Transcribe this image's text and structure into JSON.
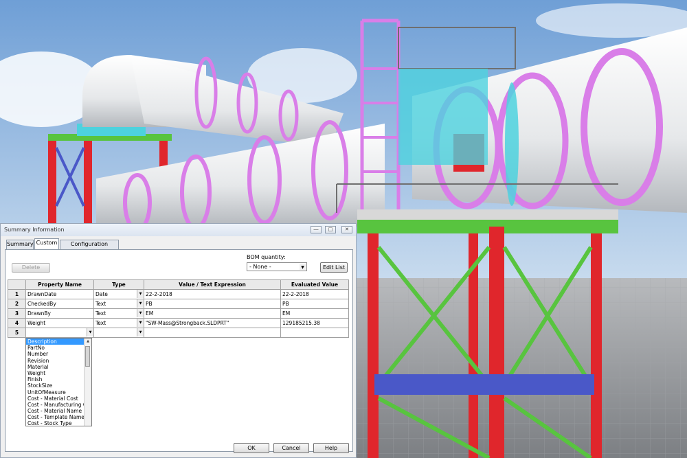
{
  "dialog": {
    "title": "Summary Information",
    "window_buttons": {
      "minimize": "―",
      "maximize": "□",
      "close": "✕"
    },
    "tabs": [
      {
        "label": "Summary",
        "active": false
      },
      {
        "label": "Custom",
        "active": true
      },
      {
        "label": "Configuration Specific",
        "active": false
      }
    ],
    "delete_label": "Delete",
    "bom_quantity_label": "BOM quantity:",
    "bom_quantity_value": "- None -",
    "edit_list_label": "Edit List",
    "columns": [
      "Property Name",
      "Type",
      "Value / Text Expression",
      "Evaluated Value"
    ],
    "rows": [
      {
        "num": "1",
        "name": "DrawnDate",
        "type": "Date",
        "value": "22-2-2018",
        "evaluated": "22-2-2018"
      },
      {
        "num": "2",
        "name": "CheckedBy",
        "type": "Text",
        "value": "PB",
        "evaluated": "PB"
      },
      {
        "num": "3",
        "name": "DrawnBy",
        "type": "Text",
        "value": "EM",
        "evaluated": "EM"
      },
      {
        "num": "4",
        "name": "Weight",
        "type": "Text",
        "value": "\"SW-Mass@Strongback.SLDPRT\"",
        "evaluated": "129185215.38"
      },
      {
        "num": "5",
        "name": "",
        "type": "",
        "value": "",
        "evaluated": ""
      }
    ],
    "dropdown_options": [
      "Description",
      "PartNo",
      "Number",
      "Revision",
      "Material",
      "Weight",
      "Finish",
      "StockSize",
      "UnitOfMeasure",
      "Cost - Material Cost",
      "Cost - Manufacturing C",
      "Cost - Material Name",
      "Cost - Template Name",
      "Cost - Stock Type"
    ],
    "dropdown_selected": "Description",
    "ok_label": "OK",
    "cancel_label": "Cancel",
    "help_label": "Help"
  },
  "colors": {
    "sky": "#9fc0e4",
    "ground": "#8f9296",
    "pipe": "#f2f3f4",
    "flange": "#d97ee8",
    "steel_red": "#e0262c",
    "brace_green": "#58c43f",
    "beam_blue": "#4a58c8",
    "cyan": "#4dd2de",
    "selection": "#3399ff"
  }
}
